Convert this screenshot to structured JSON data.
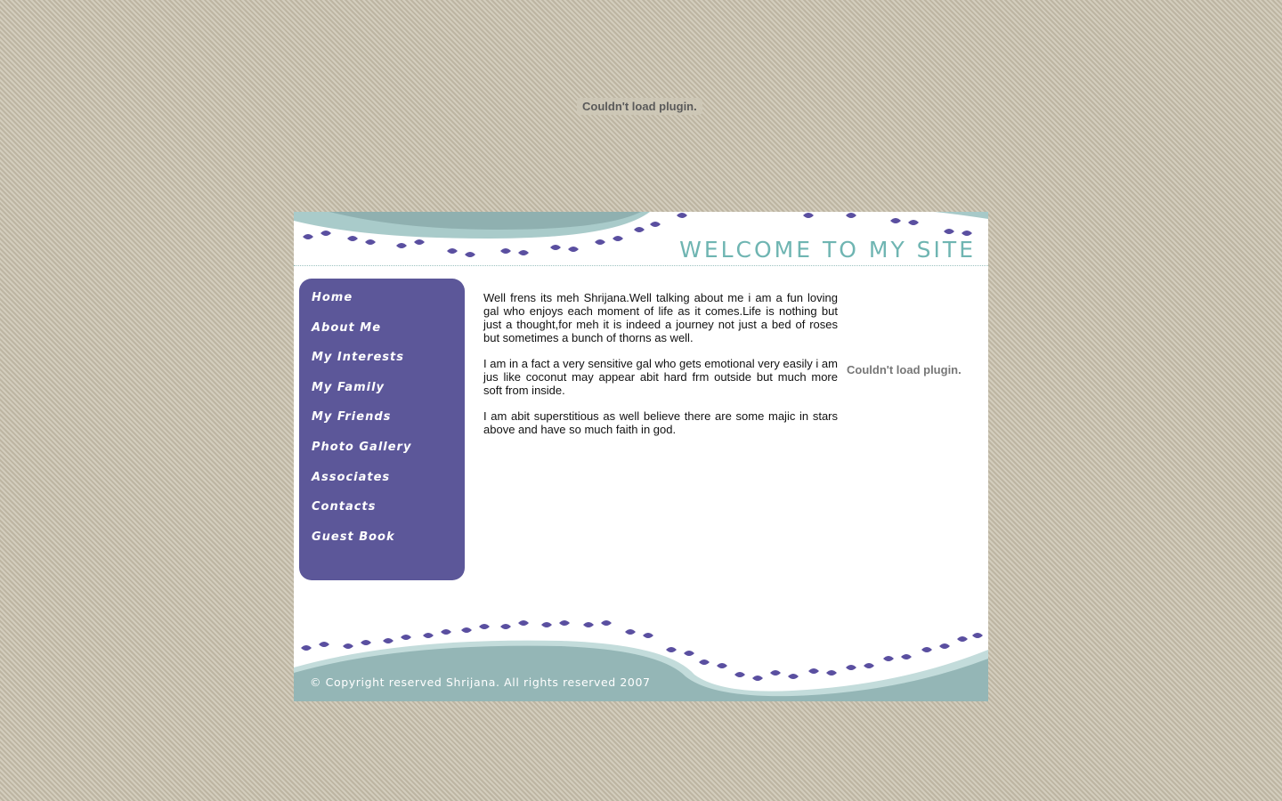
{
  "plugin_top": {
    "message": "Couldn't load plugin."
  },
  "header": {
    "welcome": "WELCOME TO MY SITE"
  },
  "nav": {
    "items": [
      {
        "label": "Home"
      },
      {
        "label": "About Me"
      },
      {
        "label": "My Interests"
      },
      {
        "label": "My Family"
      },
      {
        "label": "My Friends"
      },
      {
        "label": "Photo Gallery"
      },
      {
        "label": "Associates"
      },
      {
        "label": "Contacts"
      },
      {
        "label": "Guest Book"
      }
    ]
  },
  "content": {
    "paragraphs": [
      "Well frens its meh Shrijana.Well talking about me i am a fun loving gal who enjoys each moment of life as it comes.Life is nothing but just a thought,for meh it is indeed a journey not just a bed of roses but sometimes a bunch of thorns as well.",
      "I am in a fact a very sensitive gal who gets emotional very easily i am jus like coconut may appear abit hard frm outside but much more soft from inside.",
      "I am abit superstitious as well believe there are some majic in stars above and have so much faith in god."
    ]
  },
  "plugin_side": {
    "message": "Couldn't load plugin."
  },
  "footer": {
    "copyright": "© Copyright reserved Shrijana. All rights reserved 2007"
  },
  "colors": {
    "sidebar": "#5c5799",
    "teal": "#8fb7b6",
    "welcome": "#6fb5b2",
    "leaf": "#5a4fa0"
  }
}
